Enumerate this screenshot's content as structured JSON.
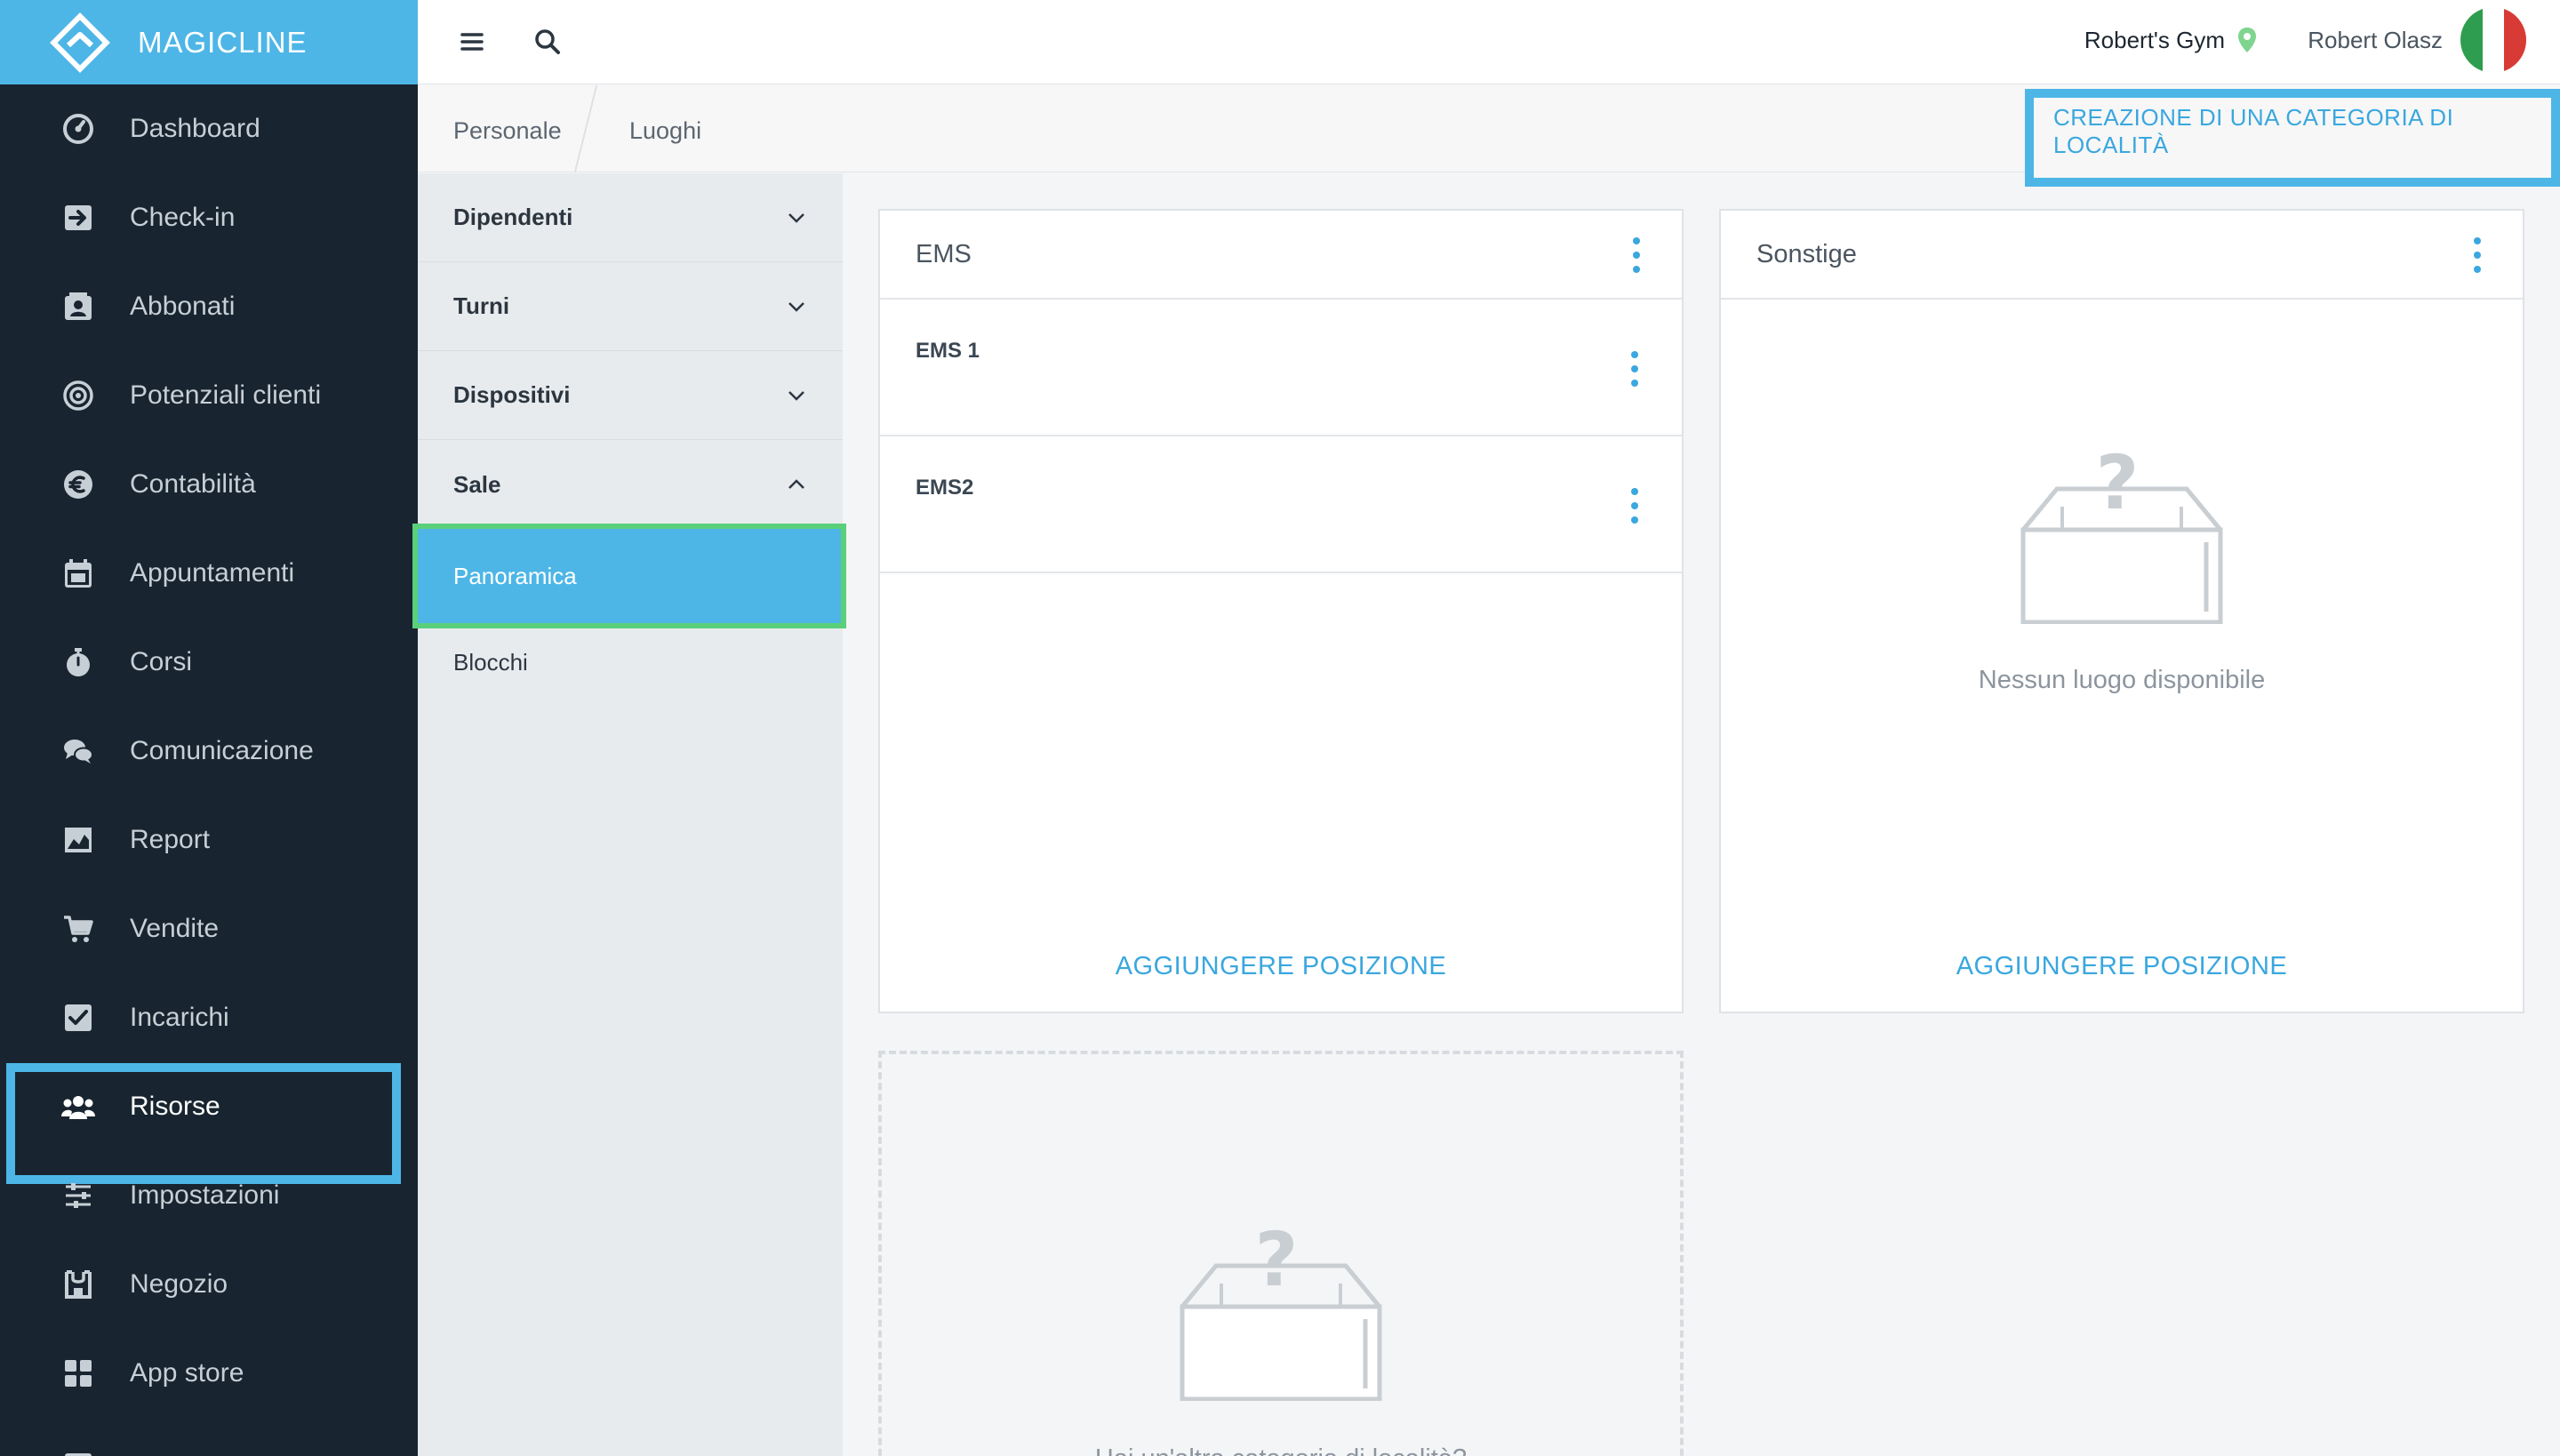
{
  "brand": {
    "name": "MAGICLINE"
  },
  "colors": {
    "accent": "#4db6e6",
    "sidebar_bg": "#18242f",
    "highlight_green": "#5ad07a",
    "link": "#3aa7df",
    "flag_green": "#2e9d4f",
    "flag_red": "#d83a35"
  },
  "sidebar": {
    "items": [
      {
        "label": "Dashboard",
        "icon": "dashboard-gauge-icon"
      },
      {
        "label": "Check-in",
        "icon": "check-in-icon"
      },
      {
        "label": "Abbonati",
        "icon": "members-card-icon"
      },
      {
        "label": "Potenziali clienti",
        "icon": "target-icon"
      },
      {
        "label": "Contabilità",
        "icon": "euro-icon"
      },
      {
        "label": "Appuntamenti",
        "icon": "calendar-icon"
      },
      {
        "label": "Corsi",
        "icon": "stopwatch-icon"
      },
      {
        "label": "Comunicazione",
        "icon": "chat-bubbles-icon"
      },
      {
        "label": "Report",
        "icon": "chart-image-icon"
      },
      {
        "label": "Vendite",
        "icon": "shopping-cart-icon"
      },
      {
        "label": "Incarichi",
        "icon": "checkbox-icon"
      },
      {
        "label": "Risorse",
        "icon": "people-group-icon",
        "active": true
      },
      {
        "label": "Impostazioni",
        "icon": "sliders-icon"
      },
      {
        "label": "Negozio",
        "icon": "shop-icon"
      },
      {
        "label": "App store",
        "icon": "grid-apps-icon"
      }
    ]
  },
  "topbar": {
    "gym": "Robert's Gym",
    "user": "Robert Olasz"
  },
  "breadcrumb": {
    "items": [
      "Personale",
      "Luoghi"
    ],
    "action_label": "CREAZIONE DI UNA CATEGORIA DI LOCALITÀ"
  },
  "subnav": {
    "groups": [
      {
        "label": "Dipendenti",
        "expanded": false
      },
      {
        "label": "Turni",
        "expanded": false
      },
      {
        "label": "Dispositivi",
        "expanded": false
      },
      {
        "label": "Sale",
        "expanded": true
      }
    ],
    "children": [
      {
        "label": "Panoramica",
        "selected": true
      },
      {
        "label": "Blocchi",
        "selected": false
      }
    ]
  },
  "cards": [
    {
      "title": "EMS",
      "locations": [
        "EMS 1",
        "EMS2"
      ],
      "add_label": "AGGIUNGERE POSIZIONE"
    },
    {
      "title": "Sonstige",
      "locations": [],
      "empty_text": "Nessun luogo disponibile",
      "add_label": "AGGIUNGERE POSIZIONE"
    }
  ],
  "new_category_card": {
    "text": "Hai un'altra categoria di località?"
  }
}
